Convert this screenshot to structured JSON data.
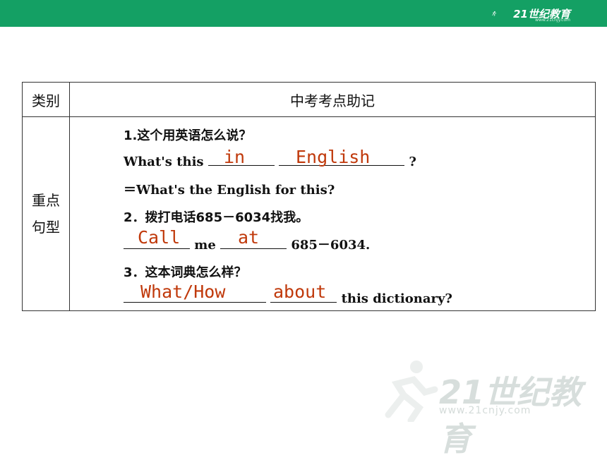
{
  "header": {
    "logo_text": "21世纪教育",
    "logo_sub": "www.21cnjy.com"
  },
  "table": {
    "col_category": "类别",
    "col_main": "中考考点助记",
    "row_category_line1": "重点",
    "row_category_line2": "句型"
  },
  "items": {
    "q1_cn": "1.这个用英语怎么说？",
    "q1_prefix": "What's this",
    "q1_suffix": "?",
    "q1_ans1": "in",
    "q1_ans2": "English",
    "q1_alt": "＝What's the English for this?",
    "q2_cn": "2．拨打电话685－6034找我。",
    "q2_mid": "me",
    "q2_suffix": "685－6034.",
    "q2_ans1": "Call",
    "q2_ans2": "at",
    "q3_cn": "3．这本词典怎么样？",
    "q3_suffix": "this dictionary?",
    "q3_ans1": "What/How",
    "q3_ans2": "about"
  },
  "watermark": {
    "text": "21世纪教育",
    "sub": "www.21cnjy.com"
  },
  "colors": {
    "topbar": "#14a064",
    "answer": "#c0390b",
    "text": "#111111",
    "border": "#333333"
  }
}
